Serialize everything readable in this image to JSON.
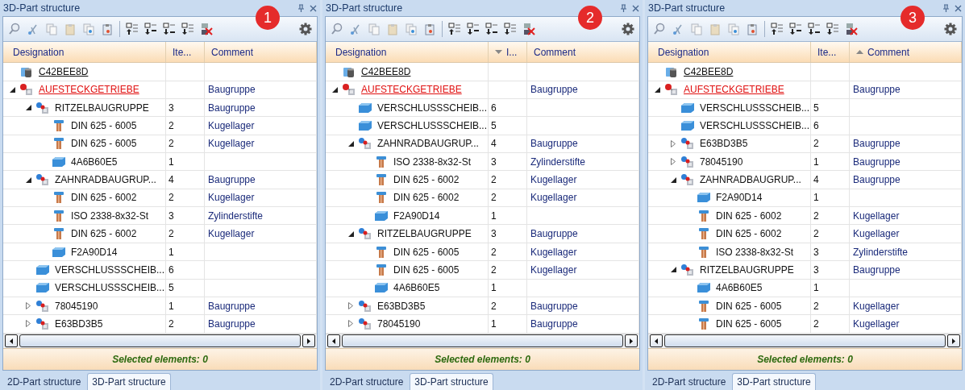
{
  "panels": [
    {
      "title": "3D-Part structure",
      "badge": "1",
      "columns": [
        {
          "label": "Designation",
          "sorted_ascending": false,
          "sorted_descending": false
        },
        {
          "label": "Ite...",
          "sorted_ascending": false,
          "sorted_descending": false
        },
        {
          "label": "Comment",
          "sorted_ascending": false,
          "sorted_descending": false
        }
      ],
      "rows": [
        {
          "kind": "root",
          "designation": "C42BEE8D"
        },
        {
          "kind": "top-assembly",
          "designation": "AUFSTECKGETRIEBE",
          "comment": "Baugruppe",
          "expanded": true,
          "children": [
            {
              "kind": "assembly",
              "designation": "RITZELBAUGRUPPE",
              "item": "3",
              "comment": "Baugruppe",
              "expanded": true,
              "children": [
                {
                  "kind": "standard-part",
                  "designation": "DIN 625 - 6005",
                  "item": "2",
                  "comment": "Kugellager"
                },
                {
                  "kind": "standard-part",
                  "designation": "DIN 625 - 6005",
                  "item": "2",
                  "comment": "Kugellager"
                },
                {
                  "kind": "part",
                  "designation": "4A6B60E5",
                  "item": "1"
                }
              ]
            },
            {
              "kind": "assembly",
              "designation": "ZAHNRADBAUGRUP...",
              "item": "4",
              "comment": "Baugruppe",
              "expanded": true,
              "children": [
                {
                  "kind": "standard-part",
                  "designation": "DIN 625 - 6002",
                  "item": "2",
                  "comment": "Kugellager"
                },
                {
                  "kind": "standard-part",
                  "designation": "ISO 2338-8x32-St",
                  "item": "3",
                  "comment": "Zylinderstifte"
                },
                {
                  "kind": "standard-part",
                  "designation": "DIN 625 - 6002",
                  "item": "2",
                  "comment": "Kugellager"
                },
                {
                  "kind": "part",
                  "designation": "F2A90D14",
                  "item": "1"
                }
              ]
            },
            {
              "kind": "part",
              "designation": "VERSCHLUSSSCHEIB...",
              "item": "6"
            },
            {
              "kind": "part",
              "designation": "VERSCHLUSSSCHEIB...",
              "item": "5"
            },
            {
              "kind": "assembly",
              "designation": "78045190",
              "item": "1",
              "comment": "Baugruppe",
              "expanded": false
            },
            {
              "kind": "assembly",
              "designation": "E63BD3B5",
              "item": "2",
              "comment": "Baugruppe",
              "expanded": false
            }
          ]
        }
      ],
      "status": "Selected elements: 0",
      "tabs": [
        {
          "label": "2D-Part structure",
          "selected": false
        },
        {
          "label": "3D-Part structure",
          "selected": true
        }
      ]
    },
    {
      "title": "3D-Part structure",
      "badge": "2",
      "columns": [
        {
          "label": "Designation",
          "sorted_ascending": false,
          "sorted_descending": false
        },
        {
          "label": "I...",
          "sorted_ascending": false,
          "sorted_descending": true
        },
        {
          "label": "Comment",
          "sorted_ascending": false,
          "sorted_descending": false
        }
      ],
      "rows": [
        {
          "kind": "root",
          "designation": "C42BEE8D"
        },
        {
          "kind": "top-assembly",
          "designation": "AUFSTECKGETRIEBE",
          "comment": "Baugruppe",
          "expanded": true,
          "children": [
            {
              "kind": "part",
              "designation": "VERSCHLUSSSCHEIB...",
              "item": "6"
            },
            {
              "kind": "part",
              "designation": "VERSCHLUSSSCHEIB...",
              "item": "5"
            },
            {
              "kind": "assembly",
              "designation": "ZAHNRADBAUGRUP...",
              "item": "4",
              "comment": "Baugruppe",
              "expanded": true,
              "children": [
                {
                  "kind": "standard-part",
                  "designation": "ISO 2338-8x32-St",
                  "item": "3",
                  "comment": "Zylinderstifte"
                },
                {
                  "kind": "standard-part",
                  "designation": "DIN 625 - 6002",
                  "item": "2",
                  "comment": "Kugellager"
                },
                {
                  "kind": "standard-part",
                  "designation": "DIN 625 - 6002",
                  "item": "2",
                  "comment": "Kugellager"
                },
                {
                  "kind": "part",
                  "designation": "F2A90D14",
                  "item": "1"
                }
              ]
            },
            {
              "kind": "assembly",
              "designation": "RITZELBAUGRUPPE",
              "item": "3",
              "comment": "Baugruppe",
              "expanded": true,
              "children": [
                {
                  "kind": "standard-part",
                  "designation": "DIN 625 - 6005",
                  "item": "2",
                  "comment": "Kugellager"
                },
                {
                  "kind": "standard-part",
                  "designation": "DIN 625 - 6005",
                  "item": "2",
                  "comment": "Kugellager"
                },
                {
                  "kind": "part",
                  "designation": "4A6B60E5",
                  "item": "1"
                }
              ]
            },
            {
              "kind": "assembly",
              "designation": "E63BD3B5",
              "item": "2",
              "comment": "Baugruppe",
              "expanded": false
            },
            {
              "kind": "assembly",
              "designation": "78045190",
              "item": "1",
              "comment": "Baugruppe",
              "expanded": false
            }
          ]
        }
      ],
      "status": "Selected elements: 0",
      "tabs": [
        {
          "label": "2D-Part structure",
          "selected": false
        },
        {
          "label": "3D-Part structure",
          "selected": true
        }
      ]
    },
    {
      "title": "3D-Part structure",
      "badge": "3",
      "columns": [
        {
          "label": "Designation",
          "sorted_ascending": false,
          "sorted_descending": false
        },
        {
          "label": "Ite...",
          "sorted_ascending": false,
          "sorted_descending": false
        },
        {
          "label": "Comment",
          "sorted_ascending": true,
          "sorted_descending": false
        }
      ],
      "rows": [
        {
          "kind": "root",
          "designation": "C42BEE8D"
        },
        {
          "kind": "top-assembly",
          "designation": "AUFSTECKGETRIEBE",
          "comment": "Baugruppe",
          "expanded": true,
          "children": [
            {
              "kind": "part",
              "designation": "VERSCHLUSSSCHEIB...",
              "item": "5"
            },
            {
              "kind": "part",
              "designation": "VERSCHLUSSSCHEIB...",
              "item": "6"
            },
            {
              "kind": "assembly",
              "designation": "E63BD3B5",
              "item": "2",
              "comment": "Baugruppe",
              "expanded": false
            },
            {
              "kind": "assembly",
              "designation": "78045190",
              "item": "1",
              "comment": "Baugruppe",
              "expanded": false
            },
            {
              "kind": "assembly",
              "designation": "ZAHNRADBAUGRUP...",
              "item": "4",
              "comment": "Baugruppe",
              "expanded": true,
              "children": [
                {
                  "kind": "part",
                  "designation": "F2A90D14",
                  "item": "1"
                },
                {
                  "kind": "standard-part",
                  "designation": "DIN 625 - 6002",
                  "item": "2",
                  "comment": "Kugellager"
                },
                {
                  "kind": "standard-part",
                  "designation": "DIN 625 - 6002",
                  "item": "2",
                  "comment": "Kugellager"
                },
                {
                  "kind": "standard-part",
                  "designation": "ISO 2338-8x32-St",
                  "item": "3",
                  "comment": "Zylinderstifte"
                }
              ]
            },
            {
              "kind": "assembly",
              "designation": "RITZELBAUGRUPPE",
              "item": "3",
              "comment": "Baugruppe",
              "expanded": true,
              "children": [
                {
                  "kind": "part",
                  "designation": "4A6B60E5",
                  "item": "1"
                },
                {
                  "kind": "standard-part",
                  "designation": "DIN 625 - 6005",
                  "item": "2",
                  "comment": "Kugellager"
                },
                {
                  "kind": "standard-part",
                  "designation": "DIN 625 - 6005",
                  "item": "2",
                  "comment": "Kugellager"
                }
              ]
            }
          ]
        }
      ],
      "status": "Selected elements: 0",
      "tabs": [
        {
          "label": "2D-Part structure",
          "selected": false
        },
        {
          "label": "3D-Part structure",
          "selected": true
        }
      ]
    }
  ]
}
